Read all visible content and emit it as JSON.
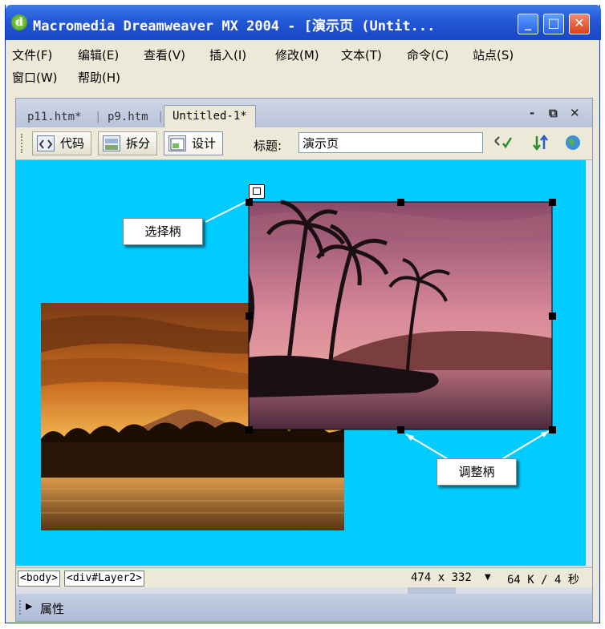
{
  "window": {
    "title": "Macromedia Dreamweaver MX 2004 - [演示页 (Untit...",
    "app_icon_glyph": "d",
    "min_glyph": "_",
    "max_glyph": "□",
    "close_glyph": "✕"
  },
  "menu": [
    "文件(F)",
    "编辑(E)",
    "查看(V)",
    "插入(I)",
    "修改(M)",
    "文本(T)",
    "命令(C)",
    "站点(S)",
    "窗口(W)",
    "帮助(H)"
  ],
  "tabs": {
    "items": [
      "p11.htm*",
      "p9.htm",
      "Untitled-1*"
    ],
    "separator": "|",
    "min_glyph": "-",
    "restore_glyph": "⧉",
    "close_glyph": "✕"
  },
  "toolbar": {
    "code_label": "代码",
    "split_label": "拆分",
    "design_label": "设计",
    "title_label": "标题:",
    "title_value": "演示页"
  },
  "canvas": {
    "bg_color": "#00ccff",
    "select_handle_label": "选择柄",
    "resize_handle_label": "调整柄"
  },
  "status": {
    "tags": [
      "<body>",
      "<div#Layer2>"
    ],
    "size": "474 x 332",
    "speed": "64 K / 4 秒"
  },
  "properties": {
    "label": "属性",
    "expand_glyph": "▶"
  }
}
